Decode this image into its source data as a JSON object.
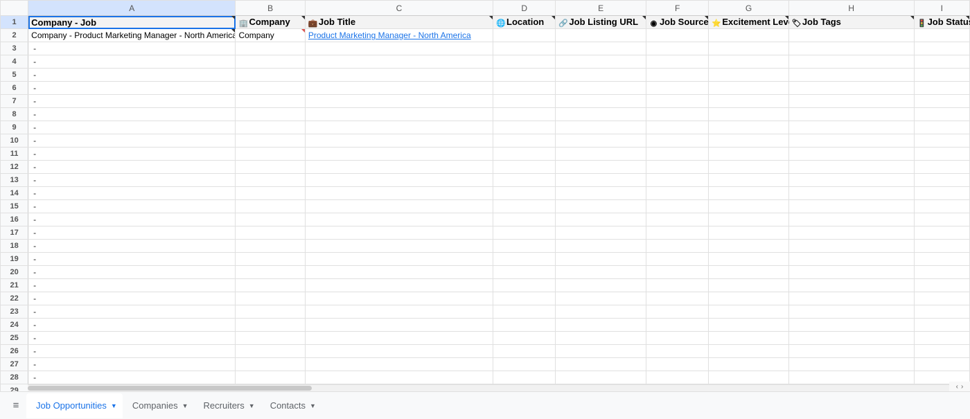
{
  "columns": [
    "A",
    "B",
    "C",
    "D",
    "E",
    "F",
    "G",
    "H",
    "I"
  ],
  "col_widths": [
    "cA",
    "cB",
    "cC",
    "cD",
    "cE",
    "cF",
    "cG",
    "cH",
    "cI"
  ],
  "headers": [
    {
      "icon": "",
      "label": "Company - Job"
    },
    {
      "icon": "🏢",
      "label": "Company"
    },
    {
      "icon": "💼",
      "label": "Job Title"
    },
    {
      "icon": "🌐",
      "label": "Location"
    },
    {
      "icon": "🔗",
      "label": "Job Listing URL"
    },
    {
      "icon": "◉",
      "label": "Job Source"
    },
    {
      "icon": "⭐",
      "label": "Excitement Level"
    },
    {
      "icon": "🏷",
      "label": "Job Tags"
    },
    {
      "icon": "🚦",
      "label": "Job Status"
    }
  ],
  "row2": {
    "a": "Company - Product Marketing Manager - North America",
    "b": "Company",
    "c": "Product Marketing Manager - North America"
  },
  "dash": "-",
  "row_count": 29,
  "tabs": [
    {
      "label": "Job Opportunities",
      "active": true
    },
    {
      "label": "Companies",
      "active": false
    },
    {
      "label": "Recruiters",
      "active": false
    },
    {
      "label": "Contacts",
      "active": false
    }
  ],
  "nav": {
    "left": "‹",
    "right": "›"
  }
}
